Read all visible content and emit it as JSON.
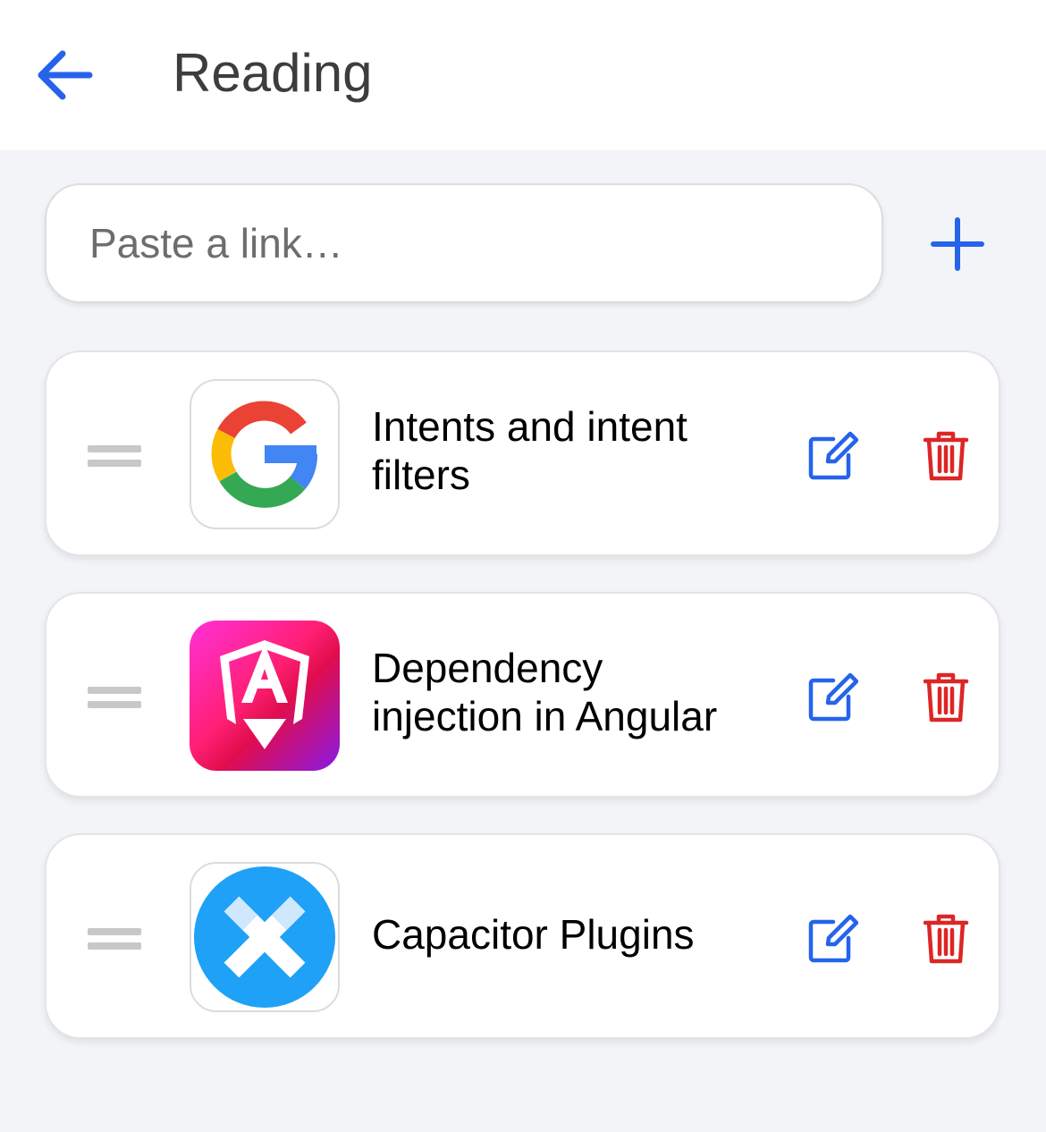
{
  "header": {
    "title": "Reading",
    "back_icon": "arrow-left-icon",
    "accent_color": "#2563eb"
  },
  "link_input": {
    "placeholder": "Paste a link…",
    "value": "",
    "add_icon": "plus-icon"
  },
  "items": [
    {
      "title_line1": "Intents and intent",
      "title_line2": "filters",
      "thumbnail": "google-logo-icon"
    },
    {
      "title_line1": "Dependency",
      "title_line2": "injection in Angular",
      "thumbnail": "angular-logo-icon"
    },
    {
      "title_line1": "Capacitor Plugins",
      "title_line2": "",
      "thumbnail": "capacitor-logo-icon"
    }
  ],
  "actions": {
    "edit_icon": "edit-icon",
    "delete_icon": "trash-icon",
    "drag_icon": "drag-handle-icon",
    "edit_color": "#2563eb",
    "delete_color": "#dc2626"
  }
}
